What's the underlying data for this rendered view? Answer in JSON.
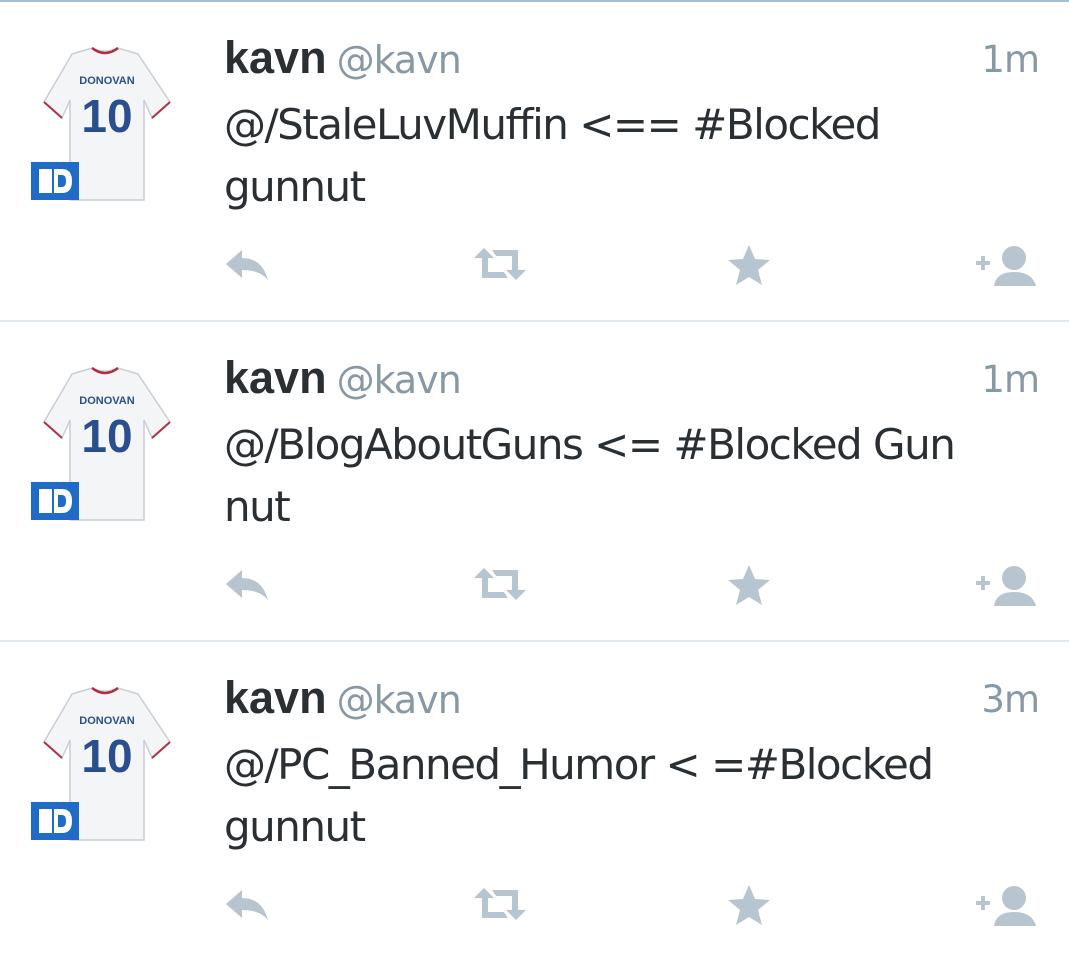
{
  "colors": {
    "name": "#292f33",
    "secondary": "#8899a6",
    "action_icon": "#b7c5d0",
    "divider": "#e1e8ed"
  },
  "tweets": [
    {
      "display_name": "kavn",
      "screen_name": "@kavn",
      "time": "1m",
      "text": "@/StaleLuvMuffin <== #Blocked\ngunnut",
      "avatar": {
        "jersey_name": "DONOVAN",
        "jersey_number": "10",
        "badge_icon": "blue-d-logo"
      }
    },
    {
      "display_name": "kavn",
      "screen_name": "@kavn",
      "time": "1m",
      "text": "@/BlogAboutGuns <= #Blocked Gun\nnut",
      "avatar": {
        "jersey_name": "DONOVAN",
        "jersey_number": "10",
        "badge_icon": "blue-d-logo"
      }
    },
    {
      "display_name": "kavn",
      "screen_name": "@kavn",
      "time": "3m",
      "text": "@/PC_Banned_Humor < =#Blocked\ngunnut",
      "avatar": {
        "jersey_name": "DONOVAN",
        "jersey_number": "10",
        "badge_icon": "blue-d-logo"
      }
    }
  ],
  "actions": [
    "reply-icon",
    "retweet-icon",
    "favorite-star-icon",
    "follow-icon"
  ]
}
